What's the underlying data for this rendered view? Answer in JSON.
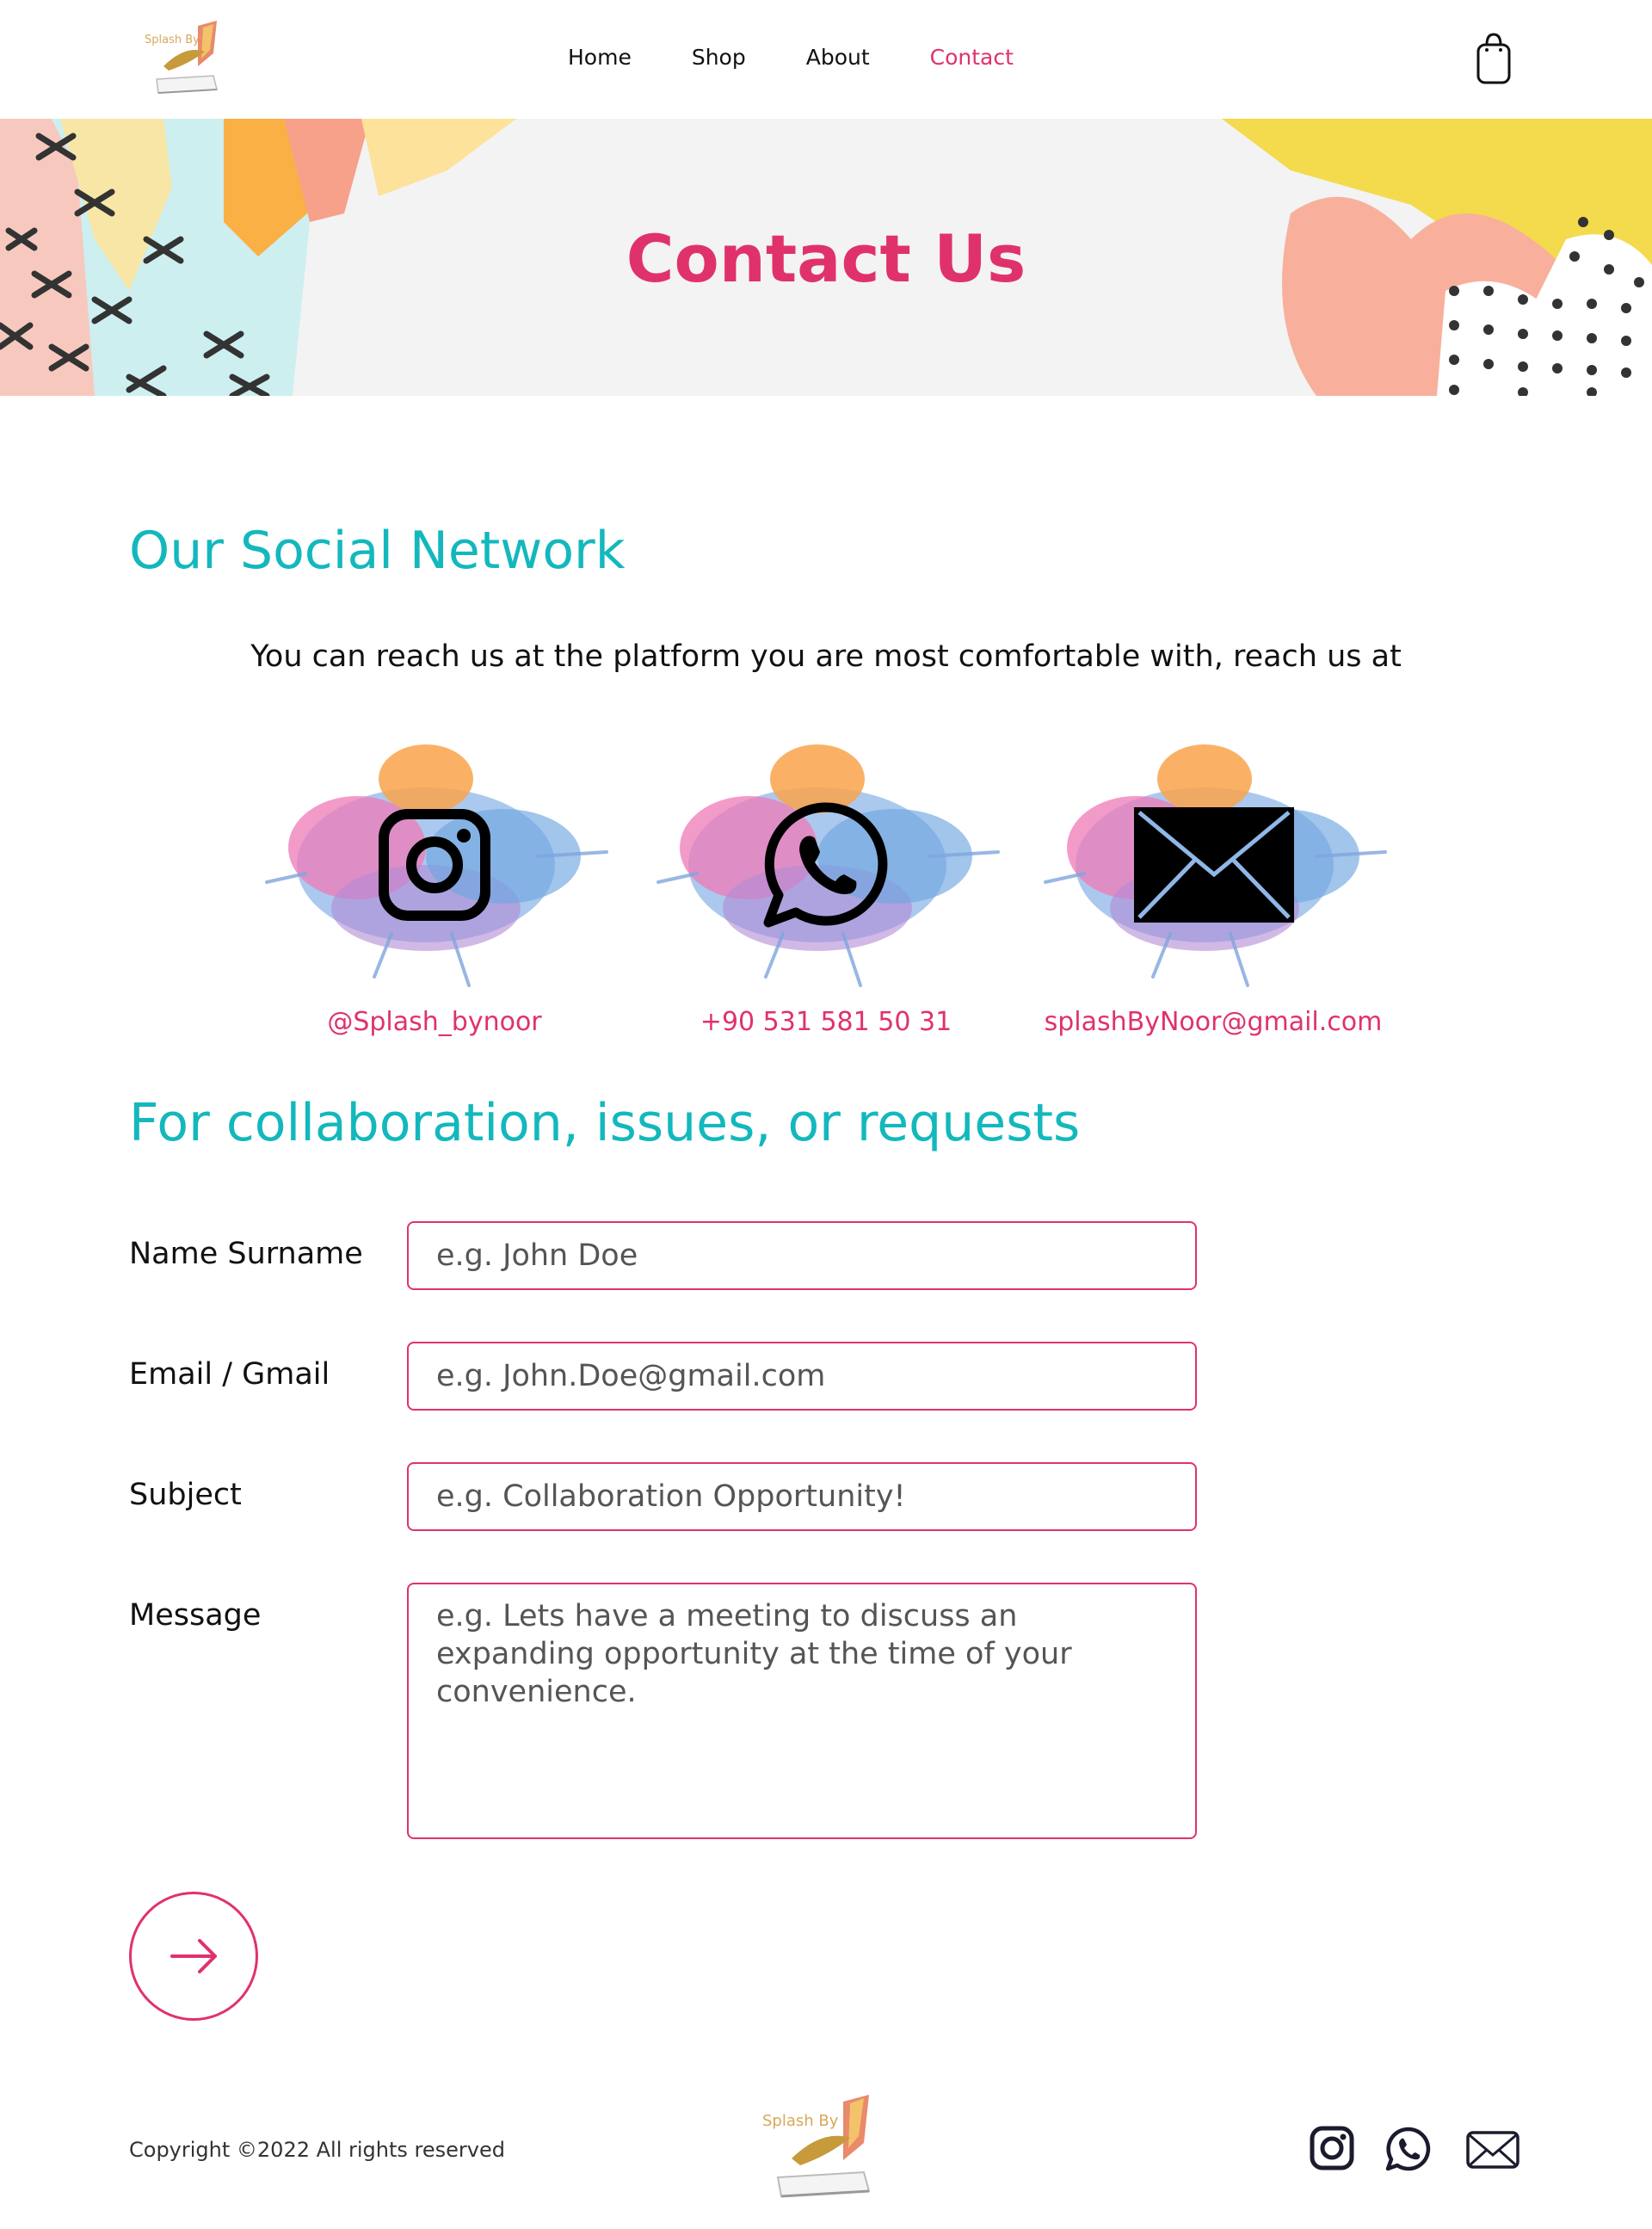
{
  "nav": {
    "logo_text": "Splash By",
    "links": [
      {
        "label": "Home"
      },
      {
        "label": "Shop"
      },
      {
        "label": "About"
      },
      {
        "label": "Contact"
      }
    ],
    "active_link": "Contact",
    "cart_icon": "shopping-bag-icon"
  },
  "hero": {
    "title": "Contact Us"
  },
  "social": {
    "title": "Our Social Network",
    "description": "You can reach us at the platform you are most comfortable with, reach us at",
    "items": [
      {
        "icon": "instagram-icon",
        "label": "@Splash_bynoor"
      },
      {
        "icon": "whatsapp-icon",
        "label": "+90 531 581 50 31"
      },
      {
        "icon": "mail-icon",
        "label": "splashByNoor@gmail.com"
      }
    ]
  },
  "form": {
    "title": "For collaboration, issues, or requests",
    "fields": [
      {
        "label": "Name Surname",
        "placeholder": "e.g. John Doe"
      },
      {
        "label": "Email / Gmail",
        "placeholder": "e.g. John.Doe@gmail.com"
      },
      {
        "label": "Subject",
        "placeholder": "e.g. Collaboration Opportunity!"
      },
      {
        "label": "Message",
        "placeholder": "e.g. Lets have a meeting to discuss an expanding opportunity at the time of your convenience."
      }
    ],
    "submit_icon": "arrow-right-icon"
  },
  "footer": {
    "copyright": "Copyright ©2022 All rights reserved",
    "icons": [
      "instagram-icon",
      "whatsapp-icon",
      "mail-icon"
    ]
  },
  "colors": {
    "accent_pink": "#e0326a",
    "accent_teal": "#13b8bd"
  }
}
